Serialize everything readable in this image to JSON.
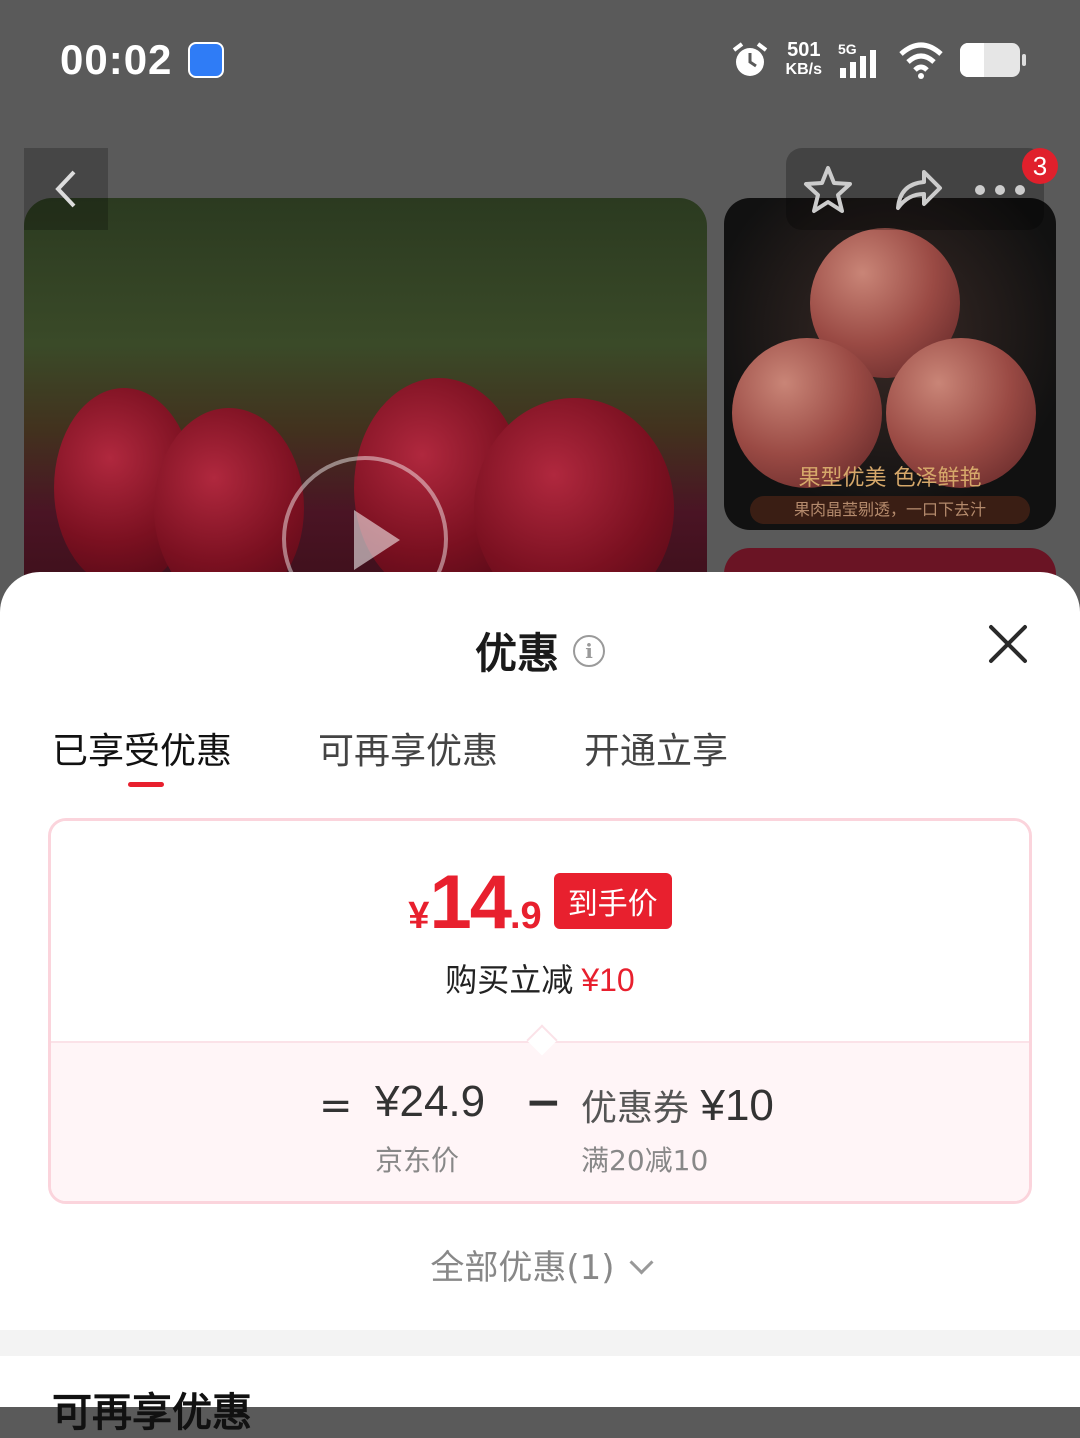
{
  "status_bar": {
    "time": "00:02",
    "net_speed_value": "501",
    "net_speed_unit": "KB/s",
    "network": "5G",
    "battery_level": 0.4
  },
  "media": {
    "side_caption_main": "果型优美 色泽鲜艳",
    "side_caption_sub": "果肉晶莹剔透，一口下去汁",
    "notification_count": "3"
  },
  "sheet": {
    "title": "优惠",
    "tabs": [
      {
        "label": "已享受优惠",
        "active": true
      },
      {
        "label": "可再享优惠",
        "active": false
      },
      {
        "label": "开通立享",
        "active": false
      }
    ],
    "final_price": {
      "currency": "¥",
      "integer": "14",
      "decimal": ".9",
      "tag": "到手价"
    },
    "discount_text": "购买立减",
    "discount_amount": "¥10",
    "formula": {
      "equals": "=",
      "jd_price": "¥24.9",
      "jd_price_label": "京东价",
      "minus": "−",
      "coupon_label": "优惠券",
      "coupon_value": "¥10",
      "coupon_condition": "满20减10"
    },
    "all_offers": "全部优惠(1)",
    "next_section_title": "可再享优惠"
  },
  "colors": {
    "accent": "#e8202e",
    "card_border": "#fbd4dc",
    "card_bottom_bg": "#fff5f7"
  }
}
